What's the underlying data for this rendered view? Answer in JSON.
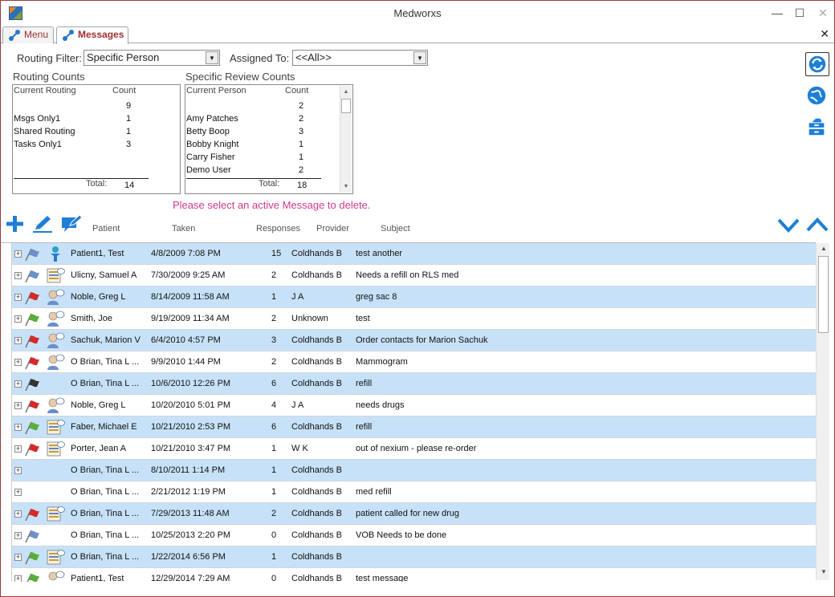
{
  "window": {
    "title": "Medworxs",
    "minimize": "—",
    "maximize": "☐",
    "close": "✕"
  },
  "tabs": [
    {
      "label": "Menu"
    },
    {
      "label": "Messages"
    }
  ],
  "tab_close": "✕",
  "filters": {
    "routing_label": "Routing Filter:",
    "routing_value": "Specific Person",
    "assigned_label": "Assigned To:",
    "assigned_value": "<<All>>"
  },
  "routing_counts": {
    "title": "Routing Counts",
    "col1": "Current Routing",
    "col2": "Count",
    "rows": [
      {
        "name": "",
        "count": "9"
      },
      {
        "name": "Msgs Only1",
        "count": "1"
      },
      {
        "name": "Shared Routing",
        "count": "1"
      },
      {
        "name": "Tasks Only1",
        "count": "3"
      }
    ],
    "total_label": "Total:",
    "total": "14"
  },
  "review_counts": {
    "title": "Specific Review Counts",
    "col1": "Current Person",
    "col2": "Count",
    "rows": [
      {
        "name": "",
        "count": "2"
      },
      {
        "name": "Amy Patches",
        "count": "2"
      },
      {
        "name": "Betty Boop",
        "count": "3"
      },
      {
        "name": "Bobby Knight",
        "count": "1"
      },
      {
        "name": "Carry Fisher",
        "count": "1"
      },
      {
        "name": "Demo User",
        "count": "2"
      }
    ],
    "total_label": "Total:",
    "total": "18"
  },
  "warning": "Please select an active Message to delete.",
  "columns": {
    "patient": "Patient",
    "taken": "Taken",
    "responses": "Responses",
    "provider": "Provider",
    "subject": "Subject"
  },
  "colors": {
    "accent": "#1e7fd6",
    "selected_row": "#c7e2f8",
    "warning": "#d13a8b",
    "title_tab": "#a03030"
  },
  "messages": [
    {
      "flag": "blue",
      "icon": "app-icon",
      "patient": "Patient1, Test",
      "taken": "4/8/2009 7:08 PM",
      "responses": "15",
      "provider": "Coldhands B",
      "subject": "test another"
    },
    {
      "flag": "blue",
      "icon": "pharmacy",
      "patient": "Ulicny, Samuel A",
      "taken": "7/30/2009 9:25 AM",
      "responses": "2",
      "provider": "Coldhands B",
      "subject": "Needs a refill on RLS med"
    },
    {
      "flag": "red",
      "icon": "person",
      "patient": "Noble, Greg L",
      "taken": "8/14/2009 11:58 AM",
      "responses": "1",
      "provider": "J A",
      "subject": "greg sac 8"
    },
    {
      "flag": "green",
      "icon": "person",
      "patient": "Smith, Joe",
      "taken": "9/19/2009 11:34 AM",
      "responses": "2",
      "provider": "Unknown",
      "subject": "test"
    },
    {
      "flag": "red",
      "icon": "person",
      "patient": "Sachuk, Marion V",
      "taken": "6/4/2010 4:57 PM",
      "responses": "3",
      "provider": "Coldhands B",
      "subject": "Order contacts for Marion Sachuk"
    },
    {
      "flag": "red",
      "icon": "person",
      "patient": "O Brian, Tina L ...",
      "taken": "9/9/2010 1:44 PM",
      "responses": "2",
      "provider": "Coldhands B",
      "subject": "Mammogram"
    },
    {
      "flag": "black",
      "icon": "",
      "patient": "O Brian, Tina L ...",
      "taken": "10/6/2010 12:26 PM",
      "responses": "6",
      "provider": "Coldhands B",
      "subject": "refill"
    },
    {
      "flag": "red",
      "icon": "person",
      "patient": "Noble, Greg L",
      "taken": "10/20/2010 5:01 PM",
      "responses": "4",
      "provider": "J A",
      "subject": "needs drugs"
    },
    {
      "flag": "green",
      "icon": "pharmacy",
      "patient": "Faber, Michael E",
      "taken": "10/21/2010 2:53 PM",
      "responses": "6",
      "provider": "Coldhands B",
      "subject": "refill"
    },
    {
      "flag": "red",
      "icon": "pharmacy",
      "patient": "Porter, Jean A",
      "taken": "10/21/2010 3:47 PM",
      "responses": "1",
      "provider": "W K",
      "subject": "out of nexium - please re-order"
    },
    {
      "flag": "",
      "icon": "",
      "patient": "O Brian, Tina L ...",
      "taken": "8/10/2011 1:14 PM",
      "responses": "1",
      "provider": "Coldhands B",
      "subject": ""
    },
    {
      "flag": "",
      "icon": "",
      "patient": "O Brian, Tina L ...",
      "taken": "2/21/2012 1:19 PM",
      "responses": "1",
      "provider": "Coldhands B",
      "subject": "med refill"
    },
    {
      "flag": "red",
      "icon": "pharmacy",
      "patient": "O Brian, Tina L ...",
      "taken": "7/29/2013 11:48 AM",
      "responses": "2",
      "provider": "Coldhands B",
      "subject": "patient called for new drug"
    },
    {
      "flag": "blue",
      "icon": "",
      "patient": "O Brian, Tina L ...",
      "taken": "10/25/2013 2:20 PM",
      "responses": "0",
      "provider": "Coldhands B",
      "subject": "VOB Needs to be done"
    },
    {
      "flag": "green",
      "icon": "pharmacy",
      "patient": "O Brian, Tina L ...",
      "taken": "1/22/2014 6:56 PM",
      "responses": "1",
      "provider": "Coldhands B",
      "subject": ""
    },
    {
      "flag": "green",
      "icon": "person",
      "patient": "Patient1, Test",
      "taken": "12/29/2014 7:29 AM",
      "responses": "0",
      "provider": "Coldhands B",
      "subject": "test message"
    }
  ]
}
